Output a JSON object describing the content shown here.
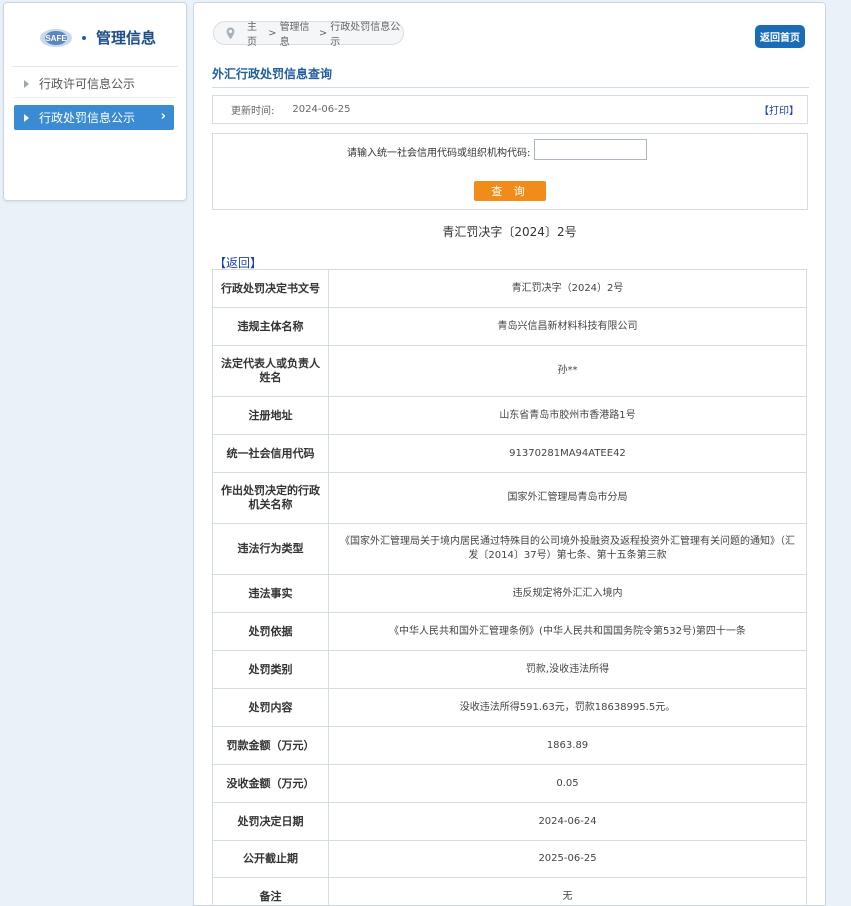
{
  "sidebar": {
    "logo_text": "SAFE",
    "title": "管理信息",
    "items": [
      {
        "label": "行政许可信息公示"
      },
      {
        "label": "行政处罚信息公示"
      }
    ]
  },
  "breadcrumb": {
    "home": "主页",
    "level2": "管理信息",
    "current": "行政处罚信息公示",
    "sep": ">"
  },
  "back_home_label": "返回首页",
  "section_title": "外汇行政处罚信息查询",
  "update": {
    "label": "更新时间:",
    "value": "2024-06-25",
    "print_label": "【打印】"
  },
  "query": {
    "label": "请输入统一社会信用代码或组织机构代码:",
    "input_value": "",
    "button_label": "查 询"
  },
  "doc_number": "青汇罚决字〔2024〕2号",
  "return_label": "【返回】",
  "colors": {
    "accent": "#1a6cb5",
    "button": "#f08c1a",
    "active_menu": "#3a8bd3"
  },
  "rows": [
    {
      "key": "行政处罚决定书文号",
      "value": "青汇罚决字（2024）2号"
    },
    {
      "key": "违规主体名称",
      "value": "青岛兴信昌新材料科技有限公司"
    },
    {
      "key": "法定代表人或负责人姓名",
      "value": "孙**"
    },
    {
      "key": "注册地址",
      "value": "山东省青岛市胶州市香港路1号"
    },
    {
      "key": "统一社会信用代码",
      "value": "91370281MA94ATEE42"
    },
    {
      "key": "作出处罚决定的行政机关名称",
      "value": "国家外汇管理局青岛市分局"
    },
    {
      "key": "违法行为类型",
      "value": "《国家外汇管理局关于境内居民通过特殊目的公司境外投融资及返程投资外汇管理有关问题的通知》（汇发〔2014〕37号）第七条、第十五条第三款"
    },
    {
      "key": "违法事实",
      "value": "违反规定将外汇汇入境内"
    },
    {
      "key": "处罚依据",
      "value": "《中华人民共和国外汇管理条例》(中华人民共和国国务院令第532号)第四十一条"
    },
    {
      "key": "处罚类别",
      "value": "罚款,没收违法所得"
    },
    {
      "key": "处罚内容",
      "value": "没收违法所得591.63元，罚款18638995.5元。"
    },
    {
      "key": "罚款金额（万元）",
      "value": "1863.89"
    },
    {
      "key": "没收金额（万元）",
      "value": "0.05"
    },
    {
      "key": "处罚决定日期",
      "value": "2024-06-24"
    },
    {
      "key": "公开截止期",
      "value": "2025-06-25"
    },
    {
      "key": "备注",
      "value": "无"
    }
  ]
}
